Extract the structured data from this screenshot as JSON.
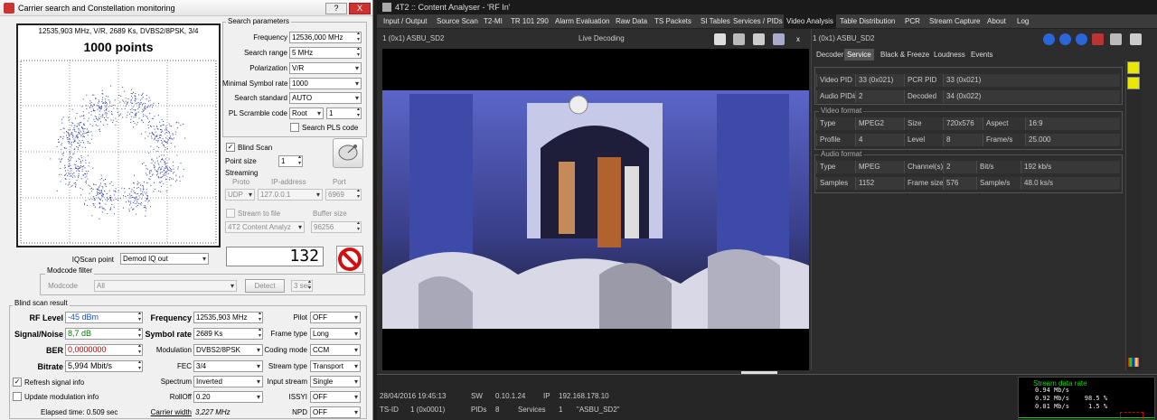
{
  "left": {
    "title": "Carrier search and Constellation monitoring",
    "title_buttons": [
      "?",
      "X"
    ],
    "constellation": {
      "info": "12535,903 MHz, V/R, 2689 Ks, DVBS2/8PSK, 3/4",
      "points_label": "1000 points"
    },
    "search_params": {
      "title": "Search parameters",
      "frequency_label": "Frequency",
      "frequency_value": "12536,000 MHz",
      "range_label": "Search range",
      "range_value": "5 MHz",
      "polarization_label": "Polarization",
      "polarization_value": "V/R",
      "min_sr_label": "Minimal Symbol rate",
      "min_sr_value": "1000",
      "standard_label": "Search standard",
      "standard_value": "AUTO",
      "pl_label": "PL Scramble code",
      "pl_mode": "Root",
      "pl_value": "1",
      "search_pls": "Search PLS code"
    },
    "blind_scan": {
      "label": "Blind Scan",
      "point_size_label": "Point size",
      "point_size_value": "1",
      "streaming_label": "Streaming",
      "proto_label": "Proto",
      "ip_label": "IP-address",
      "port_label": "Port",
      "proto_value": "UDP",
      "ip_value": "127.0.0.1",
      "port_value": "6969",
      "stream_to_file": "Stream to file",
      "buffer_label": "Buffer size",
      "app_value": "4T2 Content Analyz",
      "buffer_value": "96256"
    },
    "iqscan": {
      "label": "IQScan point",
      "value": "Demod IQ out",
      "counter": "132"
    },
    "modcode": {
      "title": "Modcode filter",
      "label": "Modcode",
      "value": "All",
      "detect": "Detect",
      "interval": "3 sec"
    },
    "result": {
      "title": "Blind scan result",
      "rf_label": "RF Level",
      "rf_value": "-45 dBm",
      "snr_label": "Signal/Noise",
      "snr_value": "8,7 dB",
      "ber_label": "BER",
      "ber_value": "0,0000000",
      "bitrate_label": "Bitrate",
      "bitrate_value": "5,994 Mbit/s",
      "refresh_label": "Refresh signal info",
      "update_label": "Update modulation info",
      "elapsed": "Elapsed time: 0.509 sec",
      "freq_label": "Frequency",
      "freq_value": "12535,903 MHz",
      "sr_label": "Symbol rate",
      "sr_value": "2689 Ks",
      "mod_label": "Modulation",
      "mod_value": "DVBS2/8PSK",
      "fec_label": "FEC",
      "fec_value": "3/4",
      "spectrum_label": "Spectrum",
      "spectrum_value": "Inverted",
      "rolloff_label": "RollOff",
      "rolloff_value": "0.20",
      "cw_label": "Carrier width",
      "cw_value": "3,227 MHz",
      "pilot_label": "Pilot",
      "pilot_value": "OFF",
      "frame_label": "Frame type",
      "frame_value": "Long",
      "coding_label": "Coding mode",
      "coding_value": "CCM",
      "stype_label": "Stream type",
      "stype_value": "Transport",
      "istream_label": "Input stream",
      "istream_value": "Single",
      "issyi_label": "ISSYI",
      "issyi_value": "OFF",
      "npd_label": "NPD",
      "npd_value": "OFF"
    }
  },
  "right": {
    "title": "4T2 :: Content Analyser - 'RF In'",
    "menu": [
      "Input / Output",
      "Source Scan",
      "T2-MI",
      "TR 101 290",
      "Alarm Evaluation",
      "Raw Data",
      "TS Packets",
      "SI Tables",
      "Services / PIDs",
      "Video Analysis",
      "Table Distribution",
      "PCR",
      "Stream Capture",
      "About",
      "Log"
    ],
    "active_menu": "Video Analysis",
    "video": {
      "channel": "1 (0x1) ASBU_SD2",
      "status": "Live Decoding",
      "close": "x"
    },
    "panel": {
      "channel": "1 (0x1) ASBU_SD2",
      "tabs": [
        "Decoder",
        "Service",
        "Black & Freeze",
        "Loudness",
        "Events"
      ],
      "active_tab": "Service",
      "video_pid_label": "Video PID",
      "video_pid_value": "33 (0x021)",
      "pcr_pid_label": "PCR PID",
      "pcr_pid_value": "33 (0x021)",
      "audio_pid_label": "Audio PID#",
      "audio_pid_value": "2",
      "decoded_label": "Decoded",
      "decoded_value": "34 (0x022)",
      "video_format_title": "Video format",
      "vf_type_label": "Type",
      "vf_type_value": "MPEG2",
      "vf_size_label": "Size",
      "vf_size_value": "720x576",
      "vf_aspect_label": "Aspect",
      "vf_aspect_value": "16:9",
      "vf_profile_label": "Profile",
      "vf_profile_value": "4",
      "vf_level_label": "Level",
      "vf_level_value": "8",
      "vf_fps_label": "Frame/s",
      "vf_fps_value": "25.000",
      "audio_format_title": "Audio format",
      "af_type_label": "Type",
      "af_type_value": "MPEG",
      "af_channels_label": "Channel(s)",
      "af_channels_value": "2",
      "af_bits_label": "Bit/s",
      "af_bits_value": "192 kb/s",
      "af_samples_label": "Samples",
      "af_samples_value": "1152",
      "af_frame_label": "Frame size",
      "af_frame_value": "576",
      "af_rate_label": "Sample/s",
      "af_rate_value": "48.0 ks/s"
    },
    "status": {
      "datetime": "28/04/2016 19:45:13",
      "sw_label": "SW",
      "sw_value": "0.10.1.24",
      "ip_label": "IP",
      "ip_value": "192.168.178.10",
      "tsid_label": "TS-ID",
      "tsid_value": "1 (0x0001)",
      "pids_label": "PIDs",
      "pids_value": "8",
      "services_label": "Services",
      "services_value": "1",
      "service_name": "\"ASBU_SD2\""
    },
    "mini_graph": {
      "title": "Stream data rate",
      "line1": "0.94 Mb/s",
      "line2": "0.92 Mb/s    98.5 %",
      "line3": "0.01 Mb/s     1.5 %"
    },
    "colors": {
      "accent_green": "#00e000",
      "active_menu_bg": "#1c1c1c",
      "rf_blue": "#1a4fd0",
      "snr_green": "#007a00",
      "ber_red": "#c00000"
    }
  }
}
